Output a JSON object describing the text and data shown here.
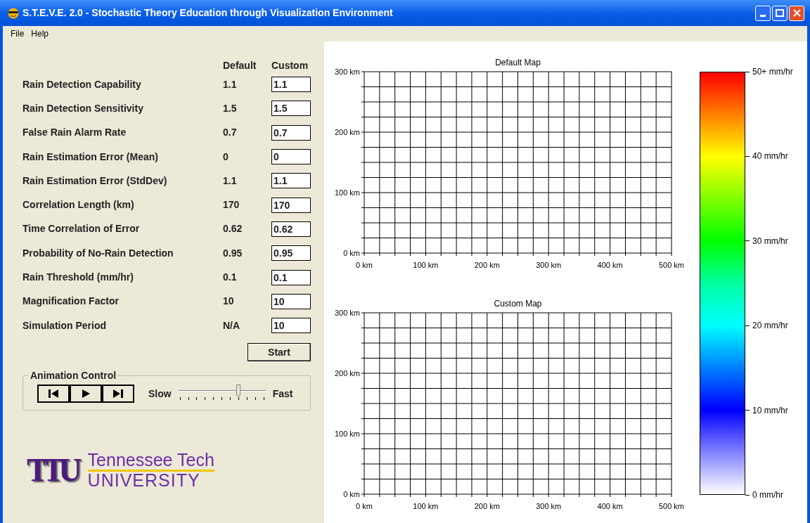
{
  "window": {
    "title": "S.T.E.V.E. 2.0 - Stochastic Theory Education through Visualization Environment"
  },
  "menu": [
    "File",
    "Help"
  ],
  "parameters": {
    "columns": [
      "Default",
      "Custom"
    ],
    "rows": [
      {
        "label": "Rain Detection Capability",
        "default": "1.1",
        "custom": "1.1"
      },
      {
        "label": "Rain Detection Sensitivity",
        "default": "1.5",
        "custom": "1.5"
      },
      {
        "label": "False Rain Alarm Rate",
        "default": "0.7",
        "custom": "0.7"
      },
      {
        "label": "Rain Estimation Error (Mean)",
        "default": "0",
        "custom": "0"
      },
      {
        "label": "Rain Estimation Error (StdDev)",
        "default": "1.1",
        "custom": "1.1"
      },
      {
        "label": "Correlation Length (km)",
        "default": "170",
        "custom": "170"
      },
      {
        "label": "Time Correlation of Error",
        "default": "0.62",
        "custom": "0.62"
      },
      {
        "label": "Probability of No-Rain Detection",
        "default": "0.95",
        "custom": "0.95"
      },
      {
        "label": "Rain Threshold (mm/hr)",
        "default": "0.1",
        "custom": "0.1"
      },
      {
        "label": "Magnification Factor",
        "default": "10",
        "custom": "10"
      },
      {
        "label": "Simulation Period",
        "default": "N/A",
        "custom": "10"
      }
    ]
  },
  "start_button": "Start",
  "animation_control": {
    "title": "Animation Control",
    "buttons": [
      {
        "kind": "first"
      },
      {
        "kind": "play"
      },
      {
        "kind": "last"
      }
    ],
    "speed": {
      "min_label": "Slow",
      "max_label": "Fast",
      "level": 0.7
    }
  },
  "logo": {
    "mark": "TTU",
    "line1": "Tennessee Tech",
    "line2": "UNIVERSITY"
  },
  "maps": [
    {
      "title": "Default Map",
      "xticks": [
        "0 km",
        "100 km",
        "200 km",
        "300 km",
        "400 km",
        "500 km"
      ],
      "yticks": [
        "300 km",
        "200 km",
        "100 km",
        "0 km"
      ]
    },
    {
      "title": "Custom Map",
      "xticks": [
        "0 km",
        "100 km",
        "200 km",
        "300 km",
        "400 km",
        "500 km"
      ],
      "yticks": [
        "300 km",
        "200 km",
        "100 km",
        "0 km"
      ]
    }
  ],
  "color_scale": {
    "labels": [
      "50+ mm/hr",
      "40 mm/hr",
      "30 mm/hr",
      "20 mm/hr",
      "10 mm/hr",
      "0 mm/hr"
    ]
  }
}
